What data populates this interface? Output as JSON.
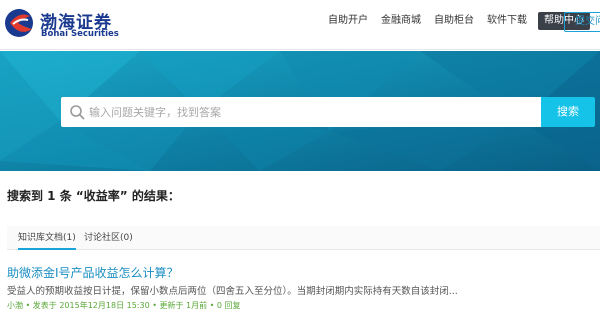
{
  "brand": {
    "name_cn": "渤海证券",
    "name_en": "Bohai Securities",
    "color": "#1a3a8f"
  },
  "nav": {
    "items": [
      "自助开户",
      "金融商城",
      "自助柜台",
      "软件下载"
    ],
    "help_label": "帮助中心",
    "submit_label": "提交问"
  },
  "search": {
    "placeholder": "输入问题关键字，找到答案",
    "button_label": "搜索",
    "button_color": "#15c2e8"
  },
  "results": {
    "heading": "搜索到 1 条 “收益率” 的结果："
  },
  "tabs": [
    {
      "label": "知识库文档(1)",
      "active": true
    },
    {
      "label": "讨论社区(0)",
      "active": false
    }
  ],
  "article": {
    "title": "助微添金I号产品收益怎么计算？",
    "summary": "受益人的预期收益按日计提，保留小数点后两位（四舍五入至分位）。当期封闭期内实际持有天数自该封闭...",
    "meta": "小渤 • 发表于 2015年12月18日 15:30 • 更新于 1月前 • 0 回复"
  },
  "icons": {
    "search": "search-icon",
    "logo": "bohai-logo-icon"
  }
}
